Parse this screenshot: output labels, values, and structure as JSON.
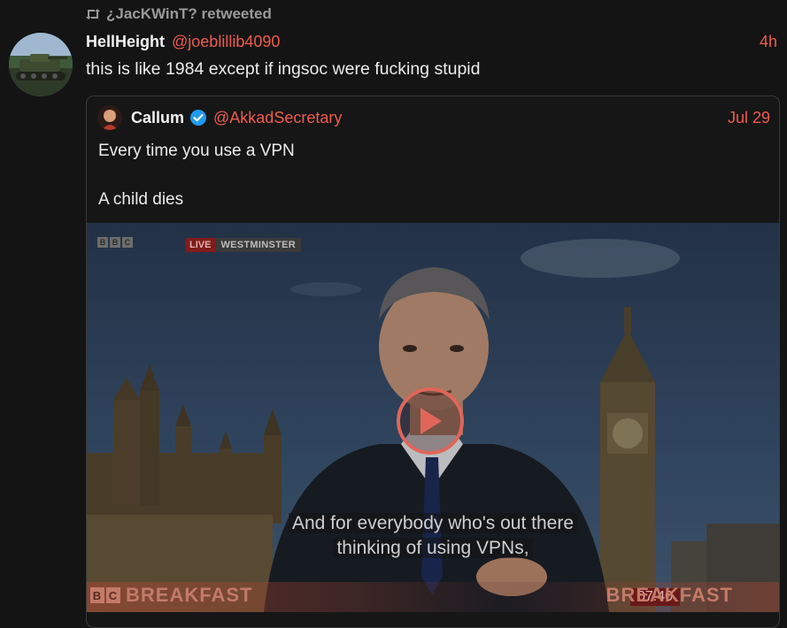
{
  "retweet": {
    "icon": "retweet-icon",
    "text": "¿JacKWinT? retweeted"
  },
  "tweet": {
    "display_name": "HellHeight",
    "handle": "@joeblillib4090",
    "time": "4h",
    "text": "this is like 1984 except if ingsoc were fucking stupid"
  },
  "quote": {
    "display_name": "Callum",
    "verified_icon": "verified-badge-icon",
    "handle": "@AkkadSecretary",
    "time": "Jul 29",
    "line1": "Every time you use a VPN",
    "line2": "A child dies",
    "video": {
      "bbc_letters": [
        "B",
        "B",
        "C"
      ],
      "live_label": "LIVE",
      "location_label": "WESTMINSTER",
      "subtitle_line1": "And for everybody who's out there",
      "subtitle_line2": "thinking of using VPNs,",
      "breakfast_left": "BREAKFAST",
      "breakfast_right": "BREAKFAST",
      "clock": "07:40",
      "play_icon": "play-icon"
    }
  },
  "colors": {
    "accent": "#ef5b4f",
    "background": "#141414",
    "verified": "#1d9bf0"
  }
}
